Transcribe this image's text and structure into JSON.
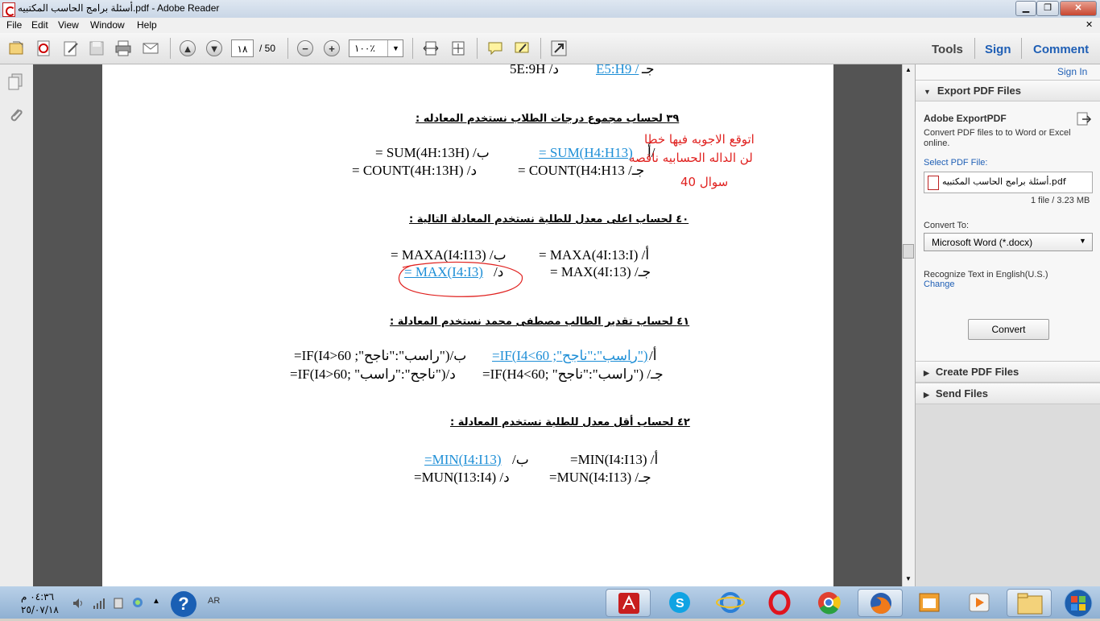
{
  "window": {
    "title": "أسئلة برامج الحاسب المكتبيه.pdf - Adobe Reader"
  },
  "menu": [
    "File",
    "Edit",
    "View",
    "Window",
    "Help"
  ],
  "toolbar": {
    "page_current": "١٨",
    "page_total": "/ 50",
    "zoom": "١٠٠٪",
    "tools": "Tools",
    "sign": "Sign",
    "comment": "Comment"
  },
  "right_panel": {
    "sign_in": "Sign In",
    "export_header": "Export PDF Files",
    "adobe_export": "Adobe ExportPDF",
    "export_desc_1": "Convert PDF files to to Word or Excel",
    "export_desc_2": "online.",
    "select_file_label": "Select PDF File:",
    "file_name": "أسئلة برامج الحاسب المكتبيه.pdf",
    "file_info": "1 file / 3.23 MB",
    "convert_to_label": "Convert To:",
    "convert_to_value": "Microsoft Word (*.docx)",
    "recognize_text": "Recognize Text in English(U.S.)",
    "change_link": "Change",
    "convert_button": "Convert",
    "create_header": "Create PDF Files",
    "send_header": "Send Files"
  },
  "document": {
    "top_line": {
      "d": "5E:9H  /د",
      "c": "E5:H9 /",
      "c_prefix": "جـ"
    },
    "q39": {
      "title": "٣٩  لحساب مجموع درجات الطلاب نستخدم المعادله :",
      "a_label": "أ/",
      "a": "= SUM(H4:H13)",
      "b": "= SUM(4H:13H) /ب",
      "c": "= COUNT(H4:H13  /جـ",
      "d": "= COUNT(4H:13H) /د"
    },
    "annotation": [
      "اتوقع الاجوبه فيها خطا",
      "لن الداله الحسابيه ناقصه",
      "سوال 40"
    ],
    "q40": {
      "title": "٤٠  لحساب اعلى معدل للطلبة نستخدم المعادلة التالية :",
      "a": "= MAXA(4I:13:I)  /أ",
      "b": "= MAXA(I4:I13) /ب",
      "c": "= MAX(4I:13) /جـ",
      "d": "=  MAX(I4:I3)",
      "d_label": "/د"
    },
    "q41": {
      "title": "٤١  لحساب تقدير الطالب مصطفى محمد نستخدم المعادلة   :",
      "a": "=IF(I4<60 ;\"راسب\":\"ناجح\")",
      "a_label": "/أ",
      "b": "=IF(I4>60 ;\"راسب\":\"ناجح\")/ب",
      "c": "=IF(H4<60; \"راسب\":\"ناجح\") /جـ",
      "d": "=IF(I4>60; \"ناجح\":\"راسب\")/د"
    },
    "q42": {
      "title": "٤٢  لحساب أقل معدل للطلبة نستخدم المعادلة :",
      "a": "=MIN(I4:I13) /أ",
      "b": "=MIN(I4:I13)",
      "b_label": "/ب",
      "c": "=MUN(I4:I13) /جـ",
      "d": "=MUN(I13:I4) /د"
    }
  },
  "taskbar": {
    "lang": "AR",
    "time": "٠٤:٣٦ م",
    "date": "٢٥/٠٧/١٨"
  }
}
